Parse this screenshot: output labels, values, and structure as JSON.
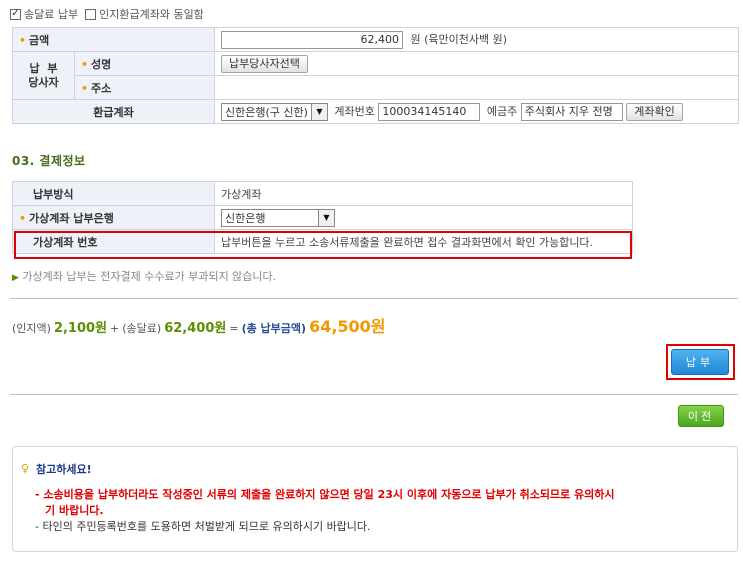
{
  "top": {
    "checkbox_label": "송달료 납부",
    "checkbox2_label": "인지환급계좌와 동일함"
  },
  "form": {
    "amount_label": "금액",
    "amount_value": "62,400",
    "amount_unit": "원 (육만이천사백 원)",
    "payer_label_line1": "납  부",
    "payer_label_line2": "당사자",
    "name_label": "성명",
    "select_payer_button": "납부당사자선택",
    "address_label": "주소",
    "refund_label": "환급계좌",
    "bank_select": "신한은행(구 신한)",
    "account_label": "계좌번호",
    "account_value": "100034145140",
    "holder_label": "예금주",
    "holder_value": "주식회사 지우 전명",
    "verify_button": "계좌확인"
  },
  "payment_section": {
    "title": "03. 결제정보",
    "method_label": "납부방식",
    "method_value": "가상계좌",
    "bank_label": "가상계좌 납부은행",
    "bank_value": "신한은행",
    "vaccount_label": "가상계좌 번호",
    "vaccount_value": "납부버튼을 누르고 소송서류제출을 완료하면 접수 결과화면에서 확인 가능합니다."
  },
  "note": "가상계좌 납부는 전자결제 수수료가 부과되지 않습니다.",
  "summary": {
    "stamp_label": "(인지액)",
    "stamp_amount": "2,100원",
    "plus": "+",
    "service_label": "(송달료)",
    "service_amount": "62,400원",
    "equals": "=",
    "total_label": "(총 납부금액)",
    "total_amount": "64,500원"
  },
  "buttons": {
    "pay": "납부",
    "prev": "이전"
  },
  "notice": {
    "title": "참고하세요!",
    "line1": "- 소송비용을 납부하더라도 작성중인 서류의 제출을 완료하지 않으면 당일 23시 이후에 자동으로 납부가 취소되므로 유의하시",
    "line1b": "기 바랍니다.",
    "line2": "- 타인의 주민등록번호를 도용하면 처벌받게 되므로 유의하시기 바랍니다."
  },
  "colors": {
    "accent_green": "#5a8f00",
    "accent_orange": "#f39800",
    "highlight_red": "#e10000",
    "pay_blue": "#1f87d6"
  }
}
